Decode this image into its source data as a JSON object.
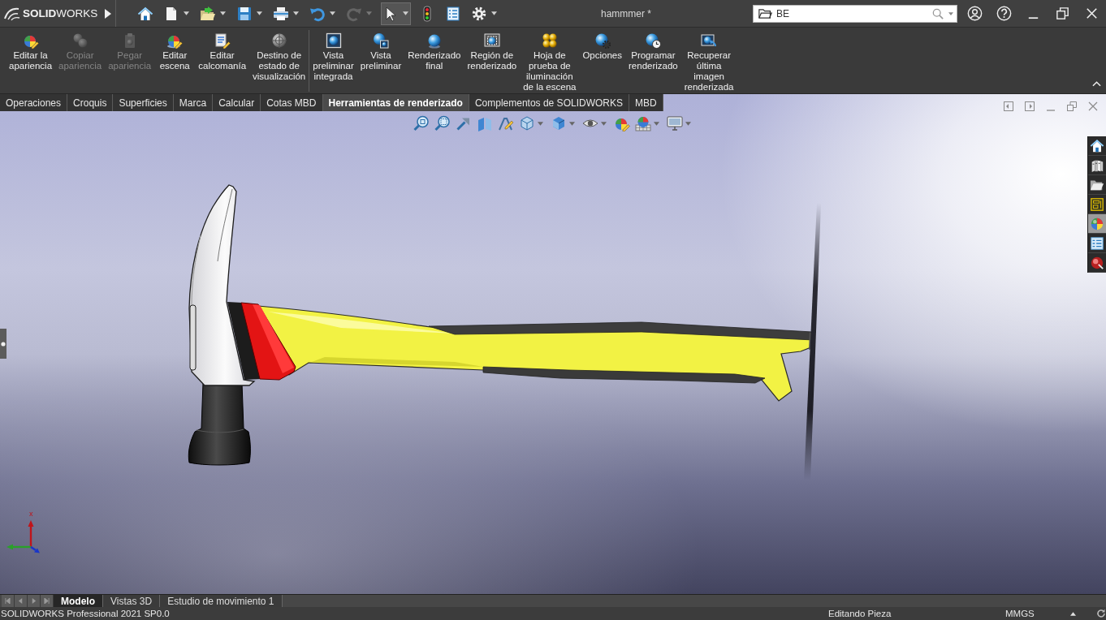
{
  "title_bar": {
    "logo": "**SOLID**WORKS",
    "quick_access": [
      {
        "kind": "home",
        "dropdown": false,
        "disabled": false,
        "selected": false
      },
      {
        "kind": "new",
        "dropdown": true,
        "disabled": false,
        "selected": false
      },
      {
        "kind": "open",
        "dropdown": true,
        "disabled": false,
        "selected": false
      },
      {
        "kind": "save",
        "dropdown": true,
        "disabled": false,
        "selected": false
      },
      {
        "kind": "print",
        "dropdown": true,
        "disabled": false,
        "selected": false
      },
      {
        "kind": "undo",
        "dropdown": true,
        "disabled": false,
        "selected": false
      },
      {
        "kind": "redo",
        "dropdown": true,
        "disabled": true,
        "selected": false
      },
      {
        "kind": "select",
        "dropdown": true,
        "disabled": false,
        "selected": true
      },
      {
        "kind": "rebuild",
        "dropdown": false,
        "disabled": false,
        "selected": false
      },
      {
        "kind": "properties",
        "dropdown": false,
        "disabled": false,
        "selected": false
      },
      {
        "kind": "options",
        "dropdown": true,
        "disabled": false,
        "selected": false
      }
    ],
    "document_title": "hammmer *",
    "search": {
      "value": "BE"
    }
  },
  "ribbon": {
    "groups": [
      [
        {
          "kind": "edit-appearance",
          "label": "Editar la\napariencia",
          "disabled": false
        },
        {
          "kind": "copy-appearance",
          "label": "Copiar\napariencia",
          "disabled": true
        },
        {
          "kind": "paste-appearance",
          "label": "Pegar\napariencia",
          "disabled": true
        },
        {
          "kind": "edit-scene",
          "label": "Editar\nescena",
          "disabled": false
        },
        {
          "kind": "edit-decal",
          "label": "Editar\ncalcomanía",
          "disabled": false
        },
        {
          "kind": "display-state",
          "label": "Destino de\nestado de\nvisualización",
          "disabled": false
        }
      ],
      [
        {
          "kind": "integrated-preview",
          "label": "Vista\npreliminar\nintegrada",
          "disabled": false
        },
        {
          "kind": "preview-window",
          "label": "Vista\npreliminar",
          "disabled": false
        },
        {
          "kind": "final-render",
          "label": "Renderizado\nfinal",
          "disabled": false
        },
        {
          "kind": "render-region",
          "label": "Región de\nrenderizado",
          "disabled": false
        },
        {
          "kind": "lighting-proof",
          "label": "Hoja de\nprueba de\niluminación\nde la escena",
          "disabled": false
        },
        {
          "kind": "render-options",
          "label": "Opciones",
          "disabled": false
        },
        {
          "kind": "schedule-render",
          "label": "Programar\nrenderizado",
          "disabled": false
        },
        {
          "kind": "recall-render",
          "label": "Recuperar\núltima\nimagen\nrenderizada",
          "disabled": false
        }
      ]
    ]
  },
  "command_tabs": [
    {
      "label": "Operaciones",
      "selected": false
    },
    {
      "label": "Croquis",
      "selected": false
    },
    {
      "label": "Superficies",
      "selected": false
    },
    {
      "label": "Marca",
      "selected": false
    },
    {
      "label": "Calcular",
      "selected": false
    },
    {
      "label": "Cotas MBD",
      "selected": false
    },
    {
      "label": "Herramientas de renderizado",
      "selected": true
    },
    {
      "label": "Complementos de SOLIDWORKS",
      "selected": false
    },
    {
      "label": "MBD",
      "selected": false
    }
  ],
  "view_toolbar": [
    {
      "kind": "zoom-fit",
      "dropdown": false
    },
    {
      "kind": "zoom-area",
      "dropdown": false
    },
    {
      "kind": "previous-view",
      "dropdown": false
    },
    {
      "kind": "section-view",
      "dropdown": false
    },
    {
      "kind": "annotation",
      "dropdown": false
    },
    {
      "kind": "orientation",
      "dropdown": true
    },
    {
      "kind": "display-style",
      "dropdown": true
    },
    {
      "kind": "hide-show",
      "dropdown": true
    },
    {
      "kind": "appearance",
      "dropdown": false
    },
    {
      "kind": "scene",
      "dropdown": true
    },
    {
      "kind": "view-settings",
      "dropdown": true
    }
  ],
  "task_pane": [
    {
      "kind": "home",
      "selected": false
    },
    {
      "kind": "library",
      "selected": false
    },
    {
      "kind": "explorer",
      "selected": false
    },
    {
      "kind": "palette",
      "selected": false
    },
    {
      "kind": "appearances",
      "selected": true
    },
    {
      "kind": "properties",
      "selected": false
    },
    {
      "kind": "forum",
      "selected": false
    }
  ],
  "triad": {
    "label": "x"
  },
  "model_tabs": [
    {
      "label": "Modelo",
      "selected": true
    },
    {
      "label": "Vistas 3D",
      "selected": false
    },
    {
      "label": "Estudio de movimiento 1",
      "selected": false
    }
  ],
  "status_bar": {
    "product": "SOLIDWORKS Professional 2021 SP0.0",
    "mode": "Editando Pieza",
    "units": "MMGS"
  }
}
